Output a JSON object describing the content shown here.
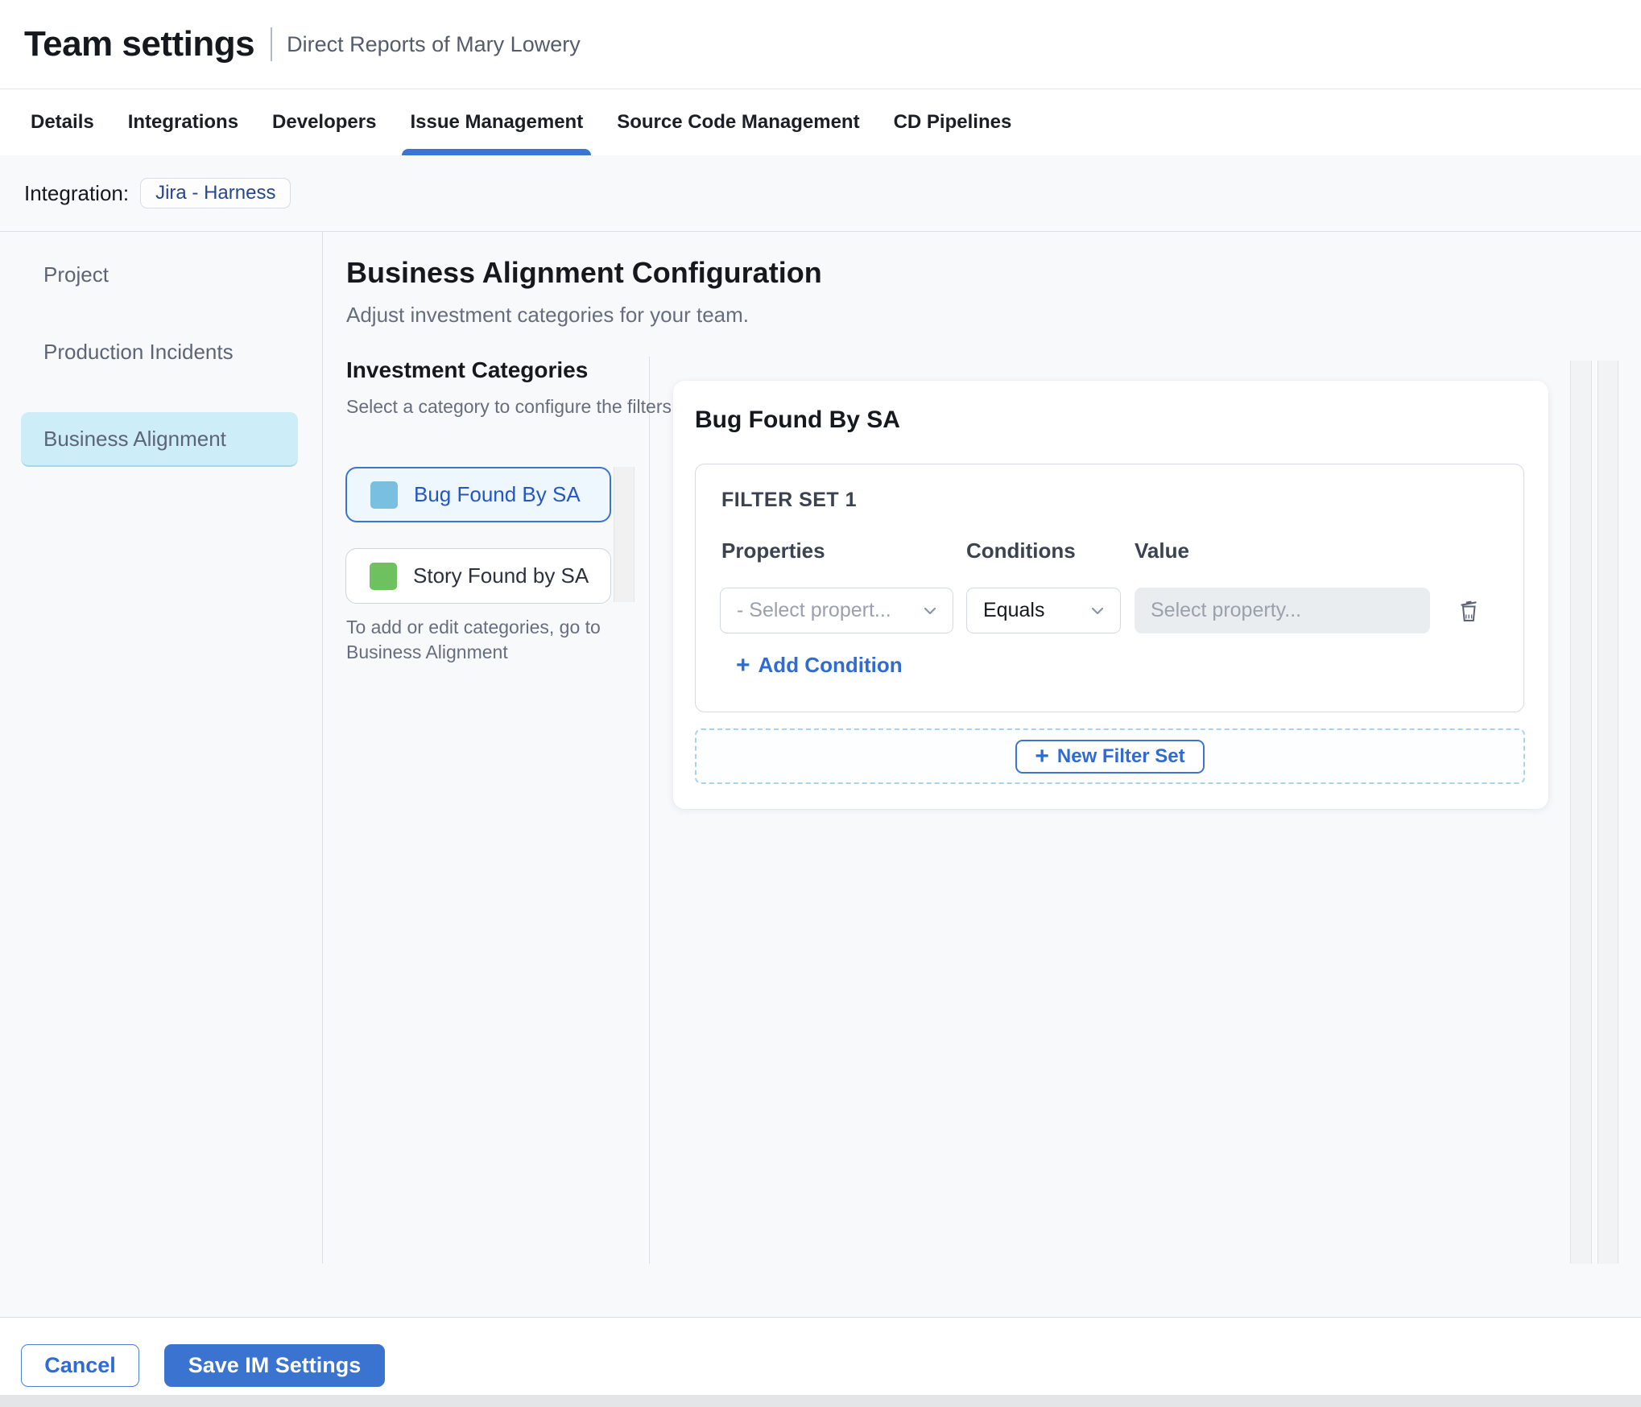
{
  "header": {
    "title": "Team settings",
    "subtitle": "Direct Reports of Mary Lowery"
  },
  "tabs": {
    "items": [
      {
        "label": "Details",
        "active": false
      },
      {
        "label": "Integrations",
        "active": false
      },
      {
        "label": "Developers",
        "active": false
      },
      {
        "label": "Issue Management",
        "active": true
      },
      {
        "label": "Source Code Management",
        "active": false
      },
      {
        "label": "CD Pipelines",
        "active": false
      }
    ]
  },
  "integration": {
    "label": "Integration:",
    "chip": "Jira - Harness"
  },
  "sidebar": {
    "items": [
      {
        "label": "Project",
        "selected": false
      },
      {
        "label": "Production Incidents",
        "selected": false
      },
      {
        "label": "Business Alignment",
        "selected": true
      }
    ]
  },
  "main": {
    "title": "Business Alignment Configuration",
    "subtitle": "Adjust investment categories for your team.",
    "categories": {
      "heading": "Investment Categories",
      "hint": "Select a category to configure the filters",
      "items": [
        {
          "label": "Bug Found By SA",
          "color": "#79C0E0",
          "selected": true
        },
        {
          "label": "Story Found by SA",
          "color": "#6EC15E",
          "selected": false
        }
      ],
      "note": "To add or edit categories, go to Business Alignment"
    },
    "panel": {
      "title": "Bug Found By SA",
      "filter_set": {
        "label": "FILTER SET 1",
        "columns": [
          "Properties",
          "Conditions",
          "Value"
        ],
        "row": {
          "property_placeholder": "- Select propert...",
          "condition_value": "Equals",
          "value_placeholder": "Select property..."
        },
        "add_condition": "Add Condition"
      },
      "new_filter_set": "New Filter Set"
    }
  },
  "footer": {
    "cancel_label": "Cancel",
    "save_label": "Save IM Settings"
  },
  "colors": {
    "accent_blue": "#3B74D1",
    "link_blue": "#2E6CD4",
    "sidebar_selected_bg": "#CDEDF8",
    "category_selected_bg": "#EEF7FD",
    "category_bug_swatch": "#79C0E0",
    "category_story_swatch": "#6EC15E",
    "content_bg": "#F8F9FB"
  }
}
